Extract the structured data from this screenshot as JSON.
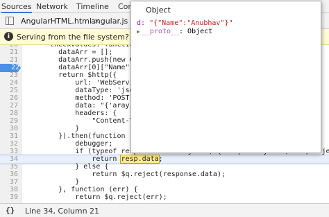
{
  "tabs": [
    "Sources",
    "Network",
    "Timeline",
    "Console"
  ],
  "files": [
    "AngularHTML.html",
    "angular.js"
  ],
  "infobar": {
    "icon": "i",
    "text": "Serving from the file system? Add your f"
  },
  "code_lines": [
    {
      "n": "20",
      "code": "      checkValues: function",
      "type": "normal"
    },
    {
      "n": "21",
      "code": "        dataArr = [];",
      "type": "normal"
    },
    {
      "n": "21",
      "code": "        dataArr.push(new O",
      "type": "normal"
    },
    {
      "n": "22",
      "code": "        dataArr[0][\"Name\"]",
      "type": "bp"
    },
    {
      "n": "23",
      "code": "        return $http({",
      "type": "normal"
    },
    {
      "n": "24",
      "code": "            url: 'WebServi",
      "type": "normal"
    },
    {
      "n": "25",
      "code": "            dataType: 'jso",
      "type": "normal"
    },
    {
      "n": "26",
      "code": "            method: 'POST'",
      "type": "normal"
    },
    {
      "n": "27",
      "code": "            data: \"{'aray'",
      "type": "normal"
    },
    {
      "n": "28",
      "code": "            headers: {",
      "type": "normal"
    },
    {
      "n": "29",
      "code": "                \"Content-T",
      "type": "normal"
    },
    {
      "n": "30",
      "code": "            }",
      "type": "normal"
    },
    {
      "n": "31",
      "code": "        }).then(function (",
      "type": "normal"
    },
    {
      "n": "32",
      "code": "            debugger;",
      "type": "normal"
    },
    {
      "n": "33",
      "code": "            if (typeof resp.data == 'object') { resp = Object (data, Object,",
      "type": "normal"
    },
    {
      "n": "34",
      "code": "                return ",
      "type": "current",
      "highlight": "resp.data",
      "after": ";"
    },
    {
      "n": "35",
      "code": "            } else {",
      "type": "normal"
    },
    {
      "n": "36",
      "code": "                return $q.reject(response.data);",
      "type": "normal"
    },
    {
      "n": "37",
      "code": "            }",
      "type": "normal"
    },
    {
      "n": "38",
      "code": "        }, function (err) {",
      "type": "normal"
    },
    {
      "n": "39",
      "code": "            return $q.reject(err);",
      "type": "normal"
    }
  ],
  "popover": {
    "title": "Object",
    "prop_key": "d:",
    "prop_value": "\"{\"Name\":\"Anubhav\"}\"",
    "proto_key": "__proto__",
    "proto_value": ": Object"
  },
  "status": {
    "braces": "{}",
    "position": "Line 34, Column 21"
  }
}
